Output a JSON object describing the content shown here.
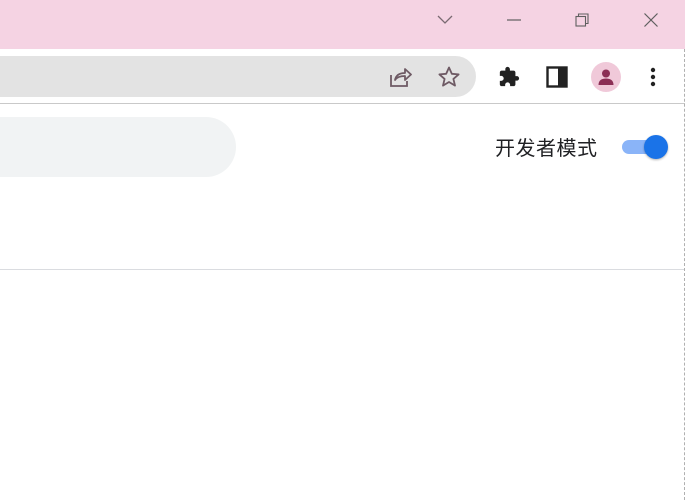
{
  "window": {
    "accent": "#f5d3e3",
    "controls": {
      "tab_search": "chevron-down-icon",
      "minimize": "minimize-icon",
      "restore": "restore-icon",
      "close": "close-icon"
    }
  },
  "toolbar": {
    "omnibox_icons": [
      "share-icon",
      "star-icon"
    ],
    "icons": [
      "extensions-icon",
      "side-panel-icon",
      "profile-avatar",
      "kebab-menu-icon"
    ]
  },
  "extensions_page": {
    "dev_mode_label": "开发者模式",
    "dev_mode_enabled": true,
    "toggle_color": "#1a73e8"
  }
}
